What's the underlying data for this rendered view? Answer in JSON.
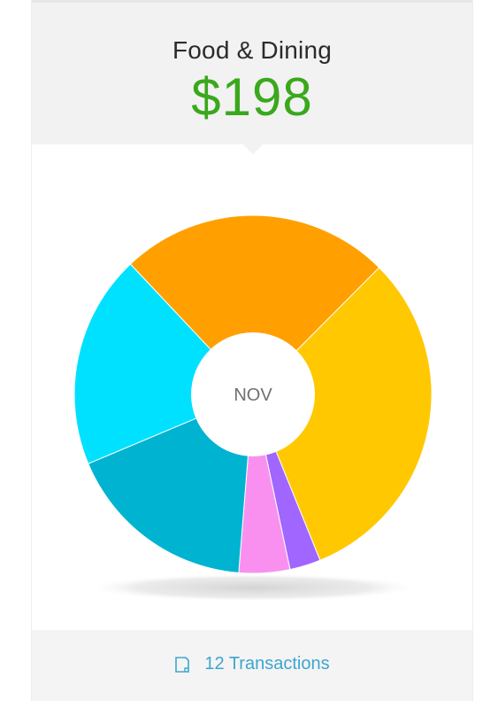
{
  "header": {
    "category": "Food & Dining",
    "amount": "$198"
  },
  "footer": {
    "transactions_label": "12 Transactions",
    "icon": "note-icon"
  },
  "colors": {
    "amount": "#3aa81c",
    "link": "#3ca6d0"
  },
  "chart_data": {
    "type": "pie",
    "style": "donut",
    "center_label": "NOV",
    "slices": [
      {
        "value": 31.4,
        "color": "#ffc800"
      },
      {
        "value": 2.8,
        "color": "#a066ff"
      },
      {
        "value": 4.6,
        "color": "#f990f0"
      },
      {
        "value": 17.4,
        "color": "#00b3d1"
      },
      {
        "value": 19.3,
        "color": "#00e0ff"
      },
      {
        "value": 24.5,
        "color": "#ffa000"
      }
    ],
    "start_angle_deg": 44.9
  }
}
